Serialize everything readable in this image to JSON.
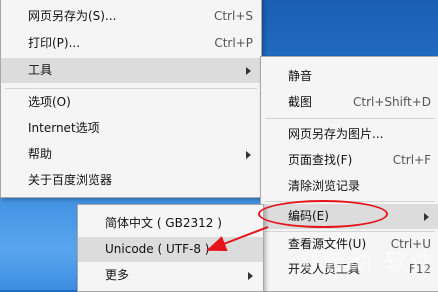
{
  "main_menu": {
    "items": [
      {
        "label": "网页另存为(S)...",
        "shortcut": "Ctrl+S"
      },
      {
        "label": "打印(P)...",
        "shortcut": "Ctrl+P"
      },
      {
        "label": "工具",
        "submenu": true
      },
      {
        "label": "选项(O)"
      },
      {
        "label": "Internet选项"
      },
      {
        "label": "帮助",
        "submenu": true
      },
      {
        "label": "关于百度浏览器"
      }
    ]
  },
  "tools_menu": {
    "items": [
      {
        "label": "静音"
      },
      {
        "label": "截图",
        "shortcut": "Ctrl+Shift+D"
      },
      {
        "label": "网页另存为图片..."
      },
      {
        "label": "页面查找(F)",
        "shortcut": "Ctrl+F"
      },
      {
        "label": "清除浏览记录"
      },
      {
        "label": "编码(E)",
        "submenu": true
      },
      {
        "label": "查看源文件(U)",
        "shortcut": "Ctrl+U"
      },
      {
        "label": "开发人员工具",
        "shortcut": "F12"
      }
    ]
  },
  "encoding_menu": {
    "items": [
      {
        "label": "简体中文 ( GB2312 )"
      },
      {
        "label": "Unicode ( UTF-8 )"
      },
      {
        "label": "更多",
        "submenu": true
      }
    ]
  },
  "annotation": {
    "color": "#e5141b"
  },
  "watermark": {
    "text": "U启动 软件中心"
  }
}
